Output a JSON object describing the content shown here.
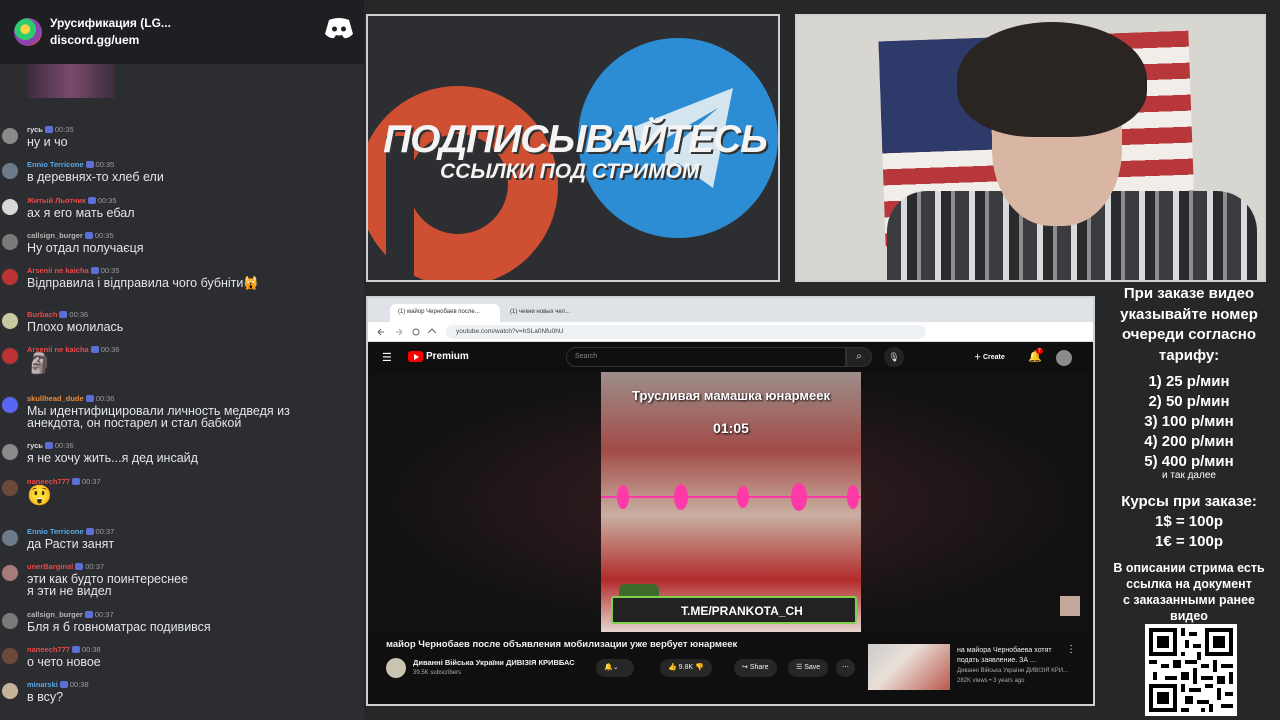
{
  "server": {
    "name": "Урусификация (LG...",
    "link": "discord.gg/uem",
    "logo_icon": "discord-logo-icon"
  },
  "chat": [
    {
      "user": "гусь",
      "color": "#dbdee1",
      "time": "00:35",
      "text": "ну и чо"
    },
    {
      "user": "Ennio Terricone",
      "color": "#5aa9e6",
      "time": "00:35",
      "text": "в деревнях-то хлеб ели"
    },
    {
      "user": "Житый Льотчик",
      "color": "#e84a4a",
      "time": "00:35",
      "text": "ах я его мать ебал"
    },
    {
      "user": "callsign_burger",
      "color": "#b5b5b5",
      "time": "00:35",
      "text": "Ну отдал получаєця"
    },
    {
      "user": "Arsenii ne kaicha",
      "color": "#e84a4a",
      "time": "00:35",
      "text": "Відправила і відправила чого бубніти🙀"
    },
    {
      "user": "Burbach",
      "color": "#e84a4a",
      "time": "00:36",
      "text": "Плохо молилась"
    },
    {
      "user": "Arsenii ne kaicha",
      "color": "#e84a4a",
      "time": "00:36",
      "text": "🗿"
    },
    {
      "user": "skullhead_dude",
      "color": "#e88a3a",
      "time": "00:36",
      "text": "Мы идентифицировали личность медведя из",
      "text2": "анекдота, он постарел и стал бабкой"
    },
    {
      "user": "гусь",
      "color": "#dbdee1",
      "time": "00:36",
      "text": "я не хочу жить...я дед инсайд"
    },
    {
      "user": "naneech777",
      "color": "#e84a4a",
      "time": "00:37",
      "text": "😲"
    },
    {
      "user": "Ennio Terricone",
      "color": "#5aa9e6",
      "time": "00:37",
      "text": "да Расти занят"
    },
    {
      "user": "unerBarginal",
      "color": "#e84a4a",
      "time": "00:37",
      "text": "эти как будто поинтереснее",
      "text2": "я эти не видел"
    },
    {
      "user": "callsign_burger",
      "color": "#b5b5b5",
      "time": "00:37",
      "text": "Бля я б говноматрас подивився"
    },
    {
      "user": "naneech777",
      "color": "#e84a4a",
      "time": "00:38",
      "text": "о чето новое"
    },
    {
      "user": "minarski",
      "color": "#5aa9e6",
      "time": "00:38",
      "text": "в всу?"
    }
  ],
  "promo": {
    "title": "ПОДПИСЫВАЙТЕСЬ",
    "subtitle": "ССЫЛКИ ПОД СТРИМОМ"
  },
  "browser": {
    "tabs": [
      "(1) майор Чернобаев после...",
      "(1) чекни новых чел..."
    ],
    "url": "youtube.com/watch?v=hSLa0Nfu0hU"
  },
  "youtube": {
    "logo": "Premium",
    "search_placeholder": "Search",
    "create": "Create",
    "notif_count": "7",
    "video_title_overlay": "Трусливая мамашка юнармеек",
    "video_time": "01:05",
    "watermark": "T.ME/PRANKOTA_CH",
    "title": "майор Чернобаев после объявления мобилизации уже вербует юнармеек",
    "channel": "Диванні Війська України ДИВІЗІЯ КРИВБАС",
    "subscribers": "39.5K subscribers",
    "likes": "9.8K",
    "share": "Share",
    "save": "Save",
    "rec_title": "на майора Чернобаева хотят подать заявление. ЗА ...",
    "rec_channel": "Диванні Війська України ДИВІЗІЯ КРИ...",
    "rec_meta": "282K views • 3 years ago"
  },
  "info": {
    "order": [
      "При заказе видео",
      "указывайте номер",
      "очереди согласно",
      "тарифу:"
    ],
    "tariffs": [
      "1) 25 р/мин",
      "2) 50 р/мин",
      "3) 100 р/мин",
      "4) 200 р/мин",
      "5) 400 р/мин"
    ],
    "and_so_on": "и так далее",
    "rates": [
      "Курсы при заказе:",
      "1$ = 100р",
      "1€ = 100р"
    ],
    "doc": [
      "В описании стрима есть",
      "ссылка на документ",
      "с заказанными ранее",
      "видео"
    ]
  },
  "colors": {
    "discord_bg": "#2b2d31",
    "youtube_red": "#ff0000",
    "telegram_blue": "#2c8dd4",
    "patreon_orange": "#cf4f33"
  }
}
